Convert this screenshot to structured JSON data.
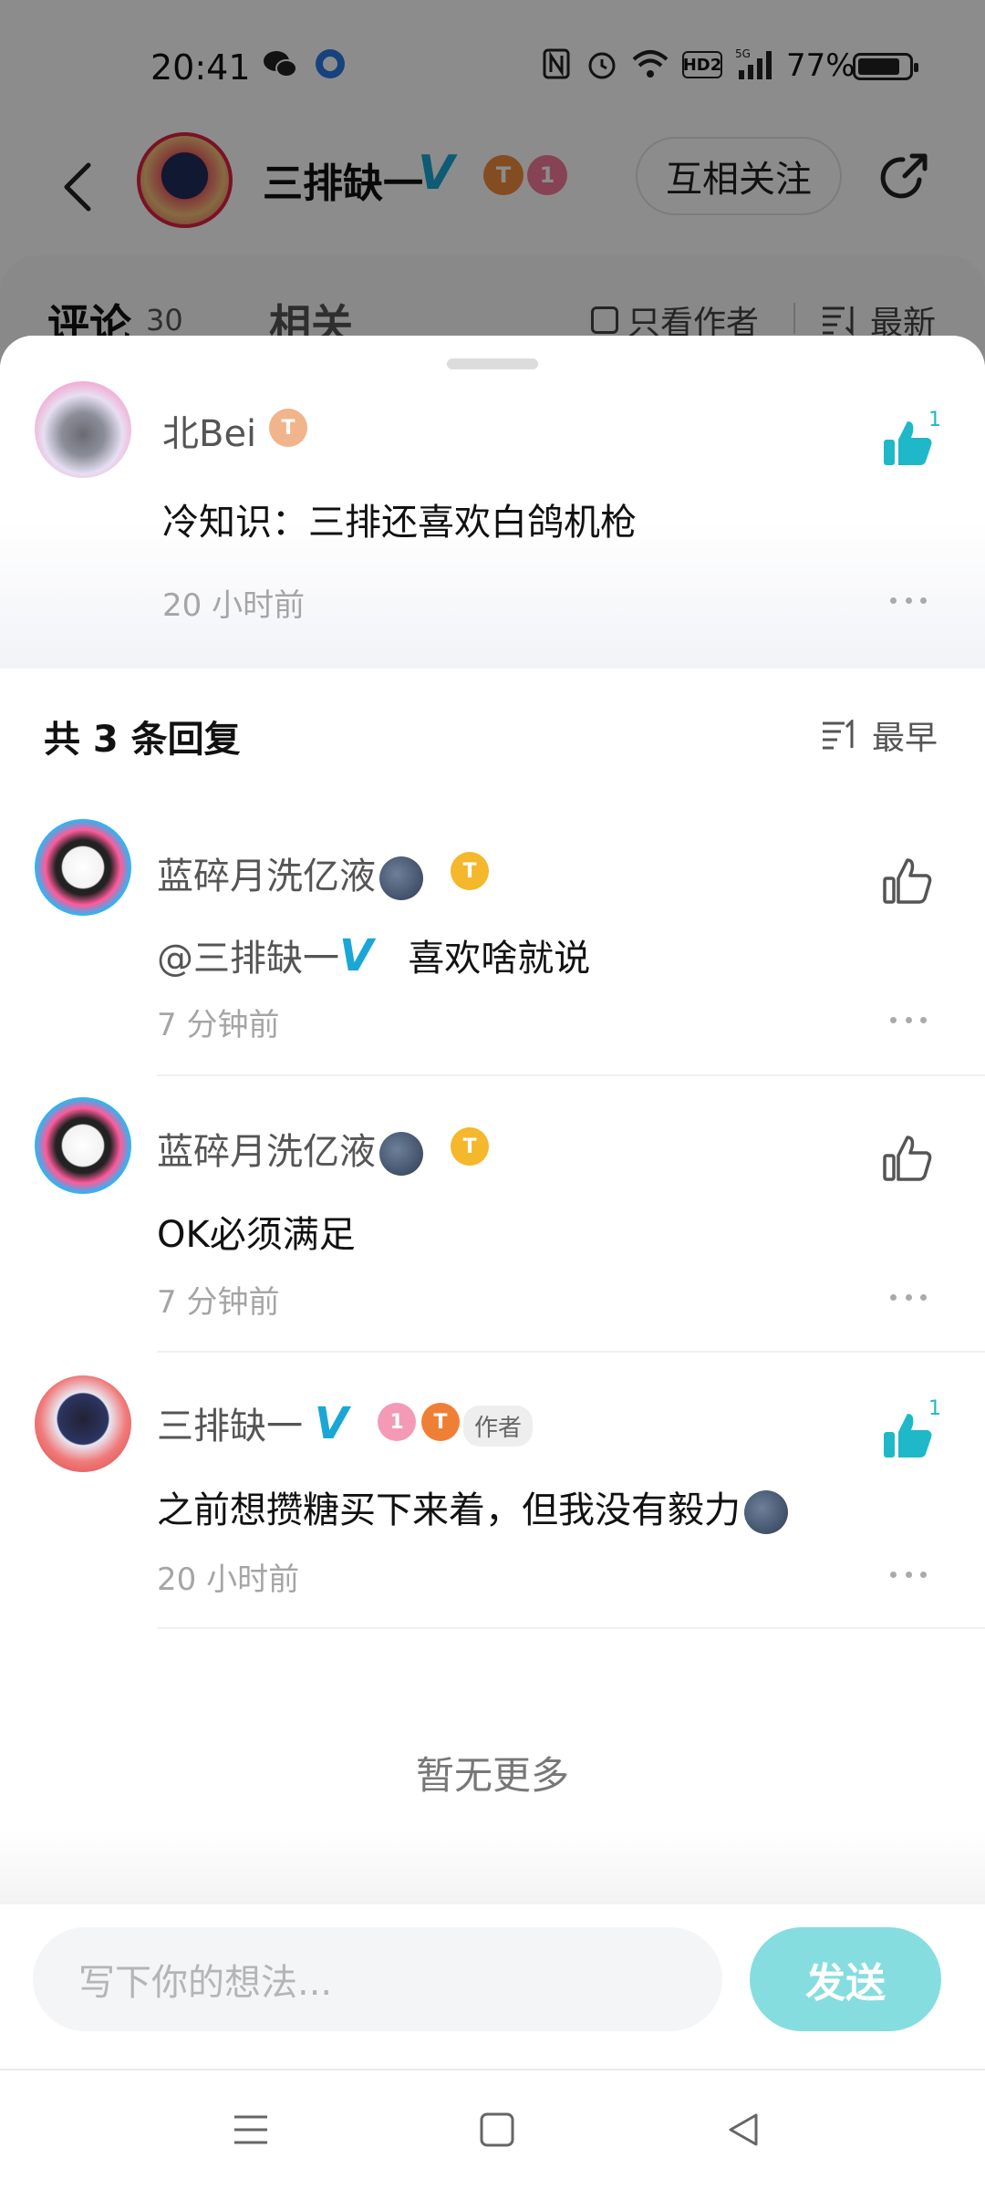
{
  "status_bar": {
    "time": "20:41",
    "battery_text": "77%",
    "battery_level": 0.77,
    "icons": [
      "wechat-icon",
      "browser-icon",
      "nfc-icon",
      "alarm-icon",
      "wifi-icon",
      "hd-icon",
      "signal-5g-icon",
      "battery-icon"
    ],
    "hd_label": "HD2",
    "net_label": "5G"
  },
  "header": {
    "user_name": "三排缺一",
    "verified_mark": "V",
    "badge1_text": "T",
    "badge2_text": "1",
    "follow_label": "互相关注"
  },
  "tabs": {
    "comment_label": "评论",
    "comment_count": "30",
    "related_label": "相关",
    "only_author_label": "只看作者",
    "sort_label": "最新"
  },
  "top_comment": {
    "name": "北Bei",
    "level": "T",
    "text": "冷知识：三排还喜欢白鸽机枪",
    "time": "20 小时前",
    "likes": "1"
  },
  "replies_header": {
    "title": "共 3 条回复",
    "sort_label": "最早"
  },
  "replies": [
    {
      "name": "蓝碎月洗亿液",
      "level": "T",
      "mention": "@三排缺一",
      "mention_mark": "V",
      "text": "喜欢啥就说",
      "time": "7 分钟前"
    },
    {
      "name": "蓝碎月洗亿液",
      "level": "T",
      "text": "OK必须满足",
      "time": "7 分钟前"
    },
    {
      "name": "三排缺一",
      "verified_mark": "V",
      "badge1_text": "1",
      "badge2_text": "T",
      "author_tag": "作者",
      "text": "之前想攒糖买下来着，但我没有毅力",
      "time": "20 小时前",
      "likes": "1"
    }
  ],
  "no_more_label": "暂无更多",
  "input": {
    "placeholder": "写下你的想法...",
    "send_label": "发送"
  },
  "colors": {
    "accent": "#1fb8c8",
    "send_button": "#86dde0",
    "verified": "#1aa7d6"
  }
}
